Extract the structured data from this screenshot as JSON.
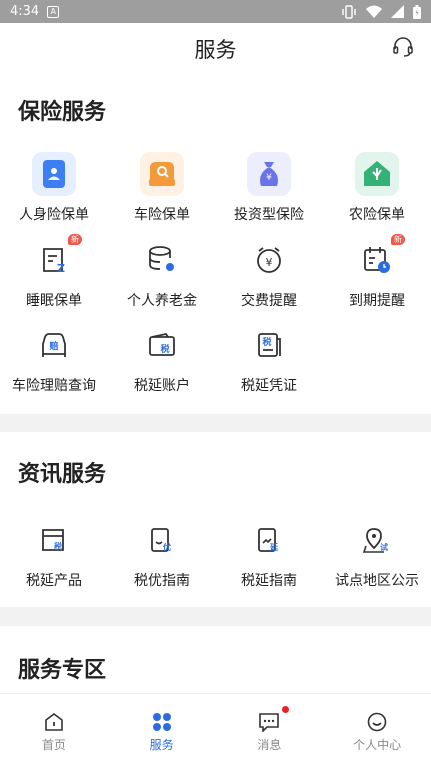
{
  "status_bar": {
    "time": "4:34",
    "notification_letter": "A",
    "icons": [
      "vibrate-icon",
      "wifi-icon",
      "signal-icon",
      "battery-icon"
    ]
  },
  "header": {
    "title": "服务",
    "icon": "headset-icon"
  },
  "insurance": {
    "title": "保险服务",
    "items": [
      {
        "label": "人身险保单",
        "icon": "person-card-icon",
        "color": "#3d7ff0"
      },
      {
        "label": "车险保单",
        "icon": "car-policy-icon",
        "color": "#f39a3a"
      },
      {
        "label": "投资型保险",
        "icon": "money-bag-icon",
        "color": "#6a74e8"
      },
      {
        "label": "农险保单",
        "icon": "farm-house-icon",
        "color": "#34b276"
      },
      {
        "label": "睡眠保单",
        "icon": "sleep-policy-icon",
        "badge": "新"
      },
      {
        "label": "个人养老金",
        "icon": "coin-stack-icon"
      },
      {
        "label": "交费提醒",
        "icon": "payment-clock-icon"
      },
      {
        "label": "到期提醒",
        "icon": "calendar-clock-icon",
        "badge": "新"
      },
      {
        "label": "车险理赔查询",
        "icon": "car-claim-icon",
        "glyph": "赔"
      },
      {
        "label": "税延账户",
        "icon": "tax-wallet-icon",
        "glyph": "税"
      },
      {
        "label": "税延凭证",
        "icon": "tax-voucher-icon",
        "glyph": "税"
      }
    ]
  },
  "info": {
    "title": "资讯服务",
    "items": [
      {
        "label": "税延产品",
        "icon": "tax-product-icon",
        "glyph": "税"
      },
      {
        "label": "税优指南",
        "icon": "tax-benefit-guide-icon",
        "glyph": "优"
      },
      {
        "label": "税延指南",
        "icon": "tax-deferral-guide-icon",
        "glyph": "延"
      },
      {
        "label": "试点地区公示",
        "icon": "pilot-region-icon",
        "glyph": "试"
      }
    ]
  },
  "zone": {
    "title": "服务专区"
  },
  "tabbar": {
    "tabs": [
      {
        "label": "首页",
        "icon": "home-icon"
      },
      {
        "label": "服务",
        "icon": "grid-icon",
        "active": true
      },
      {
        "label": "消息",
        "icon": "message-icon",
        "unread": true
      },
      {
        "label": "个人中心",
        "icon": "smile-icon"
      }
    ]
  },
  "colors": {
    "accent": "#2b6de0",
    "outline_icon": "#333333",
    "badge": "#f05a4a",
    "unread_dot": "#e8202a"
  }
}
